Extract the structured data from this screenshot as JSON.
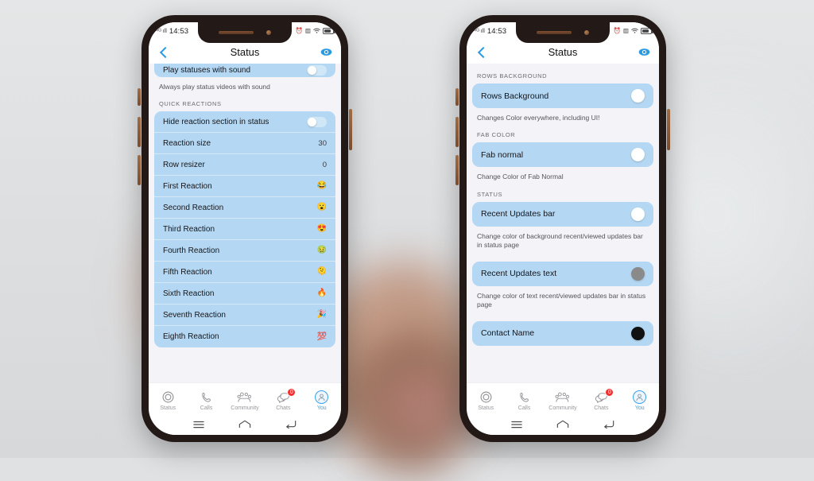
{
  "background": {
    "color": "#dfe1e3"
  },
  "status_bar": {
    "time": "14:53",
    "signal_icon": "signal-4g-icon",
    "alarm_icon": "alarm-icon",
    "vibrate_icon": "vibrate-icon",
    "wifi_icon": "wifi-icon",
    "battery_icon": "battery-icon"
  },
  "header": {
    "title": "Status",
    "back_icon": "back-chevron-icon",
    "eye_icon": "eye-icon"
  },
  "bottom_nav": {
    "items": [
      {
        "label": "Status",
        "icon": "status-ring-icon",
        "active": false,
        "badge": null
      },
      {
        "label": "Calls",
        "icon": "phone-icon",
        "active": false,
        "badge": null
      },
      {
        "label": "Community",
        "icon": "community-icon",
        "active": false,
        "badge": null
      },
      {
        "label": "Chats",
        "icon": "chat-bubbles-icon",
        "active": false,
        "badge": "0"
      },
      {
        "label": "You",
        "icon": "avatar-icon",
        "active": true,
        "badge": null
      }
    ]
  },
  "gesture_bar": {
    "recents_icon": "recents-icon",
    "home_icon": "home-icon",
    "back_icon": "android-back-icon"
  },
  "left_phone": {
    "partial_row": {
      "label": "Play statuses with sound",
      "toggle": "off",
      "description": "Always play status videos with sound"
    },
    "section": {
      "label": "QUICK REACTIONS",
      "rows": [
        {
          "label": "Hide reaction section in status",
          "control": "toggle",
          "value": "off"
        },
        {
          "label": "Reaction size",
          "control": "value",
          "value": "30"
        },
        {
          "label": "Row resizer",
          "control": "value",
          "value": "0"
        },
        {
          "label": "First Reaction",
          "control": "emoji",
          "value": "😂"
        },
        {
          "label": "Second Reaction",
          "control": "emoji",
          "value": "😮"
        },
        {
          "label": "Third Reaction",
          "control": "emoji",
          "value": "😍"
        },
        {
          "label": "Fourth Reaction",
          "control": "emoji",
          "value": "🤢"
        },
        {
          "label": "Fifth Reaction",
          "control": "emoji",
          "value": "🫠"
        },
        {
          "label": "Sixth Reaction",
          "control": "emoji",
          "value": "🔥"
        },
        {
          "label": "Seventh Reaction",
          "control": "emoji",
          "value": "🎉"
        },
        {
          "label": "Eighth Reaction",
          "control": "emoji",
          "value": "💯"
        }
      ]
    }
  },
  "right_phone": {
    "groups": [
      {
        "section_label": "ROWS BACKGROUND",
        "row_label": "Rows Background",
        "swatch_color": "#ffffff",
        "description": "Changes Color everywhere, including UI!"
      },
      {
        "section_label": "FAB COLOR",
        "row_label": "Fab normal",
        "swatch_color": "#ffffff",
        "description": "Change Color of Fab Normal"
      },
      {
        "section_label": "STATUS",
        "row_label": "Recent Updates bar",
        "swatch_color": "#ffffff",
        "description": "Change color of background recent/viewed updates bar in status page"
      },
      {
        "section_label": "",
        "row_label": "Recent Updates text",
        "swatch_color": "#8a8a8a",
        "description": "Change color of text recent/viewed updates bar in status page"
      },
      {
        "section_label": "",
        "row_label": "Contact Name",
        "swatch_color": "#111111",
        "description": ""
      }
    ]
  },
  "colors": {
    "row_blue": "#b4d8f3",
    "accent_blue": "#2b9ae0",
    "badge_red": "#f02f2f",
    "screen_bg": "#f4f4f8"
  }
}
